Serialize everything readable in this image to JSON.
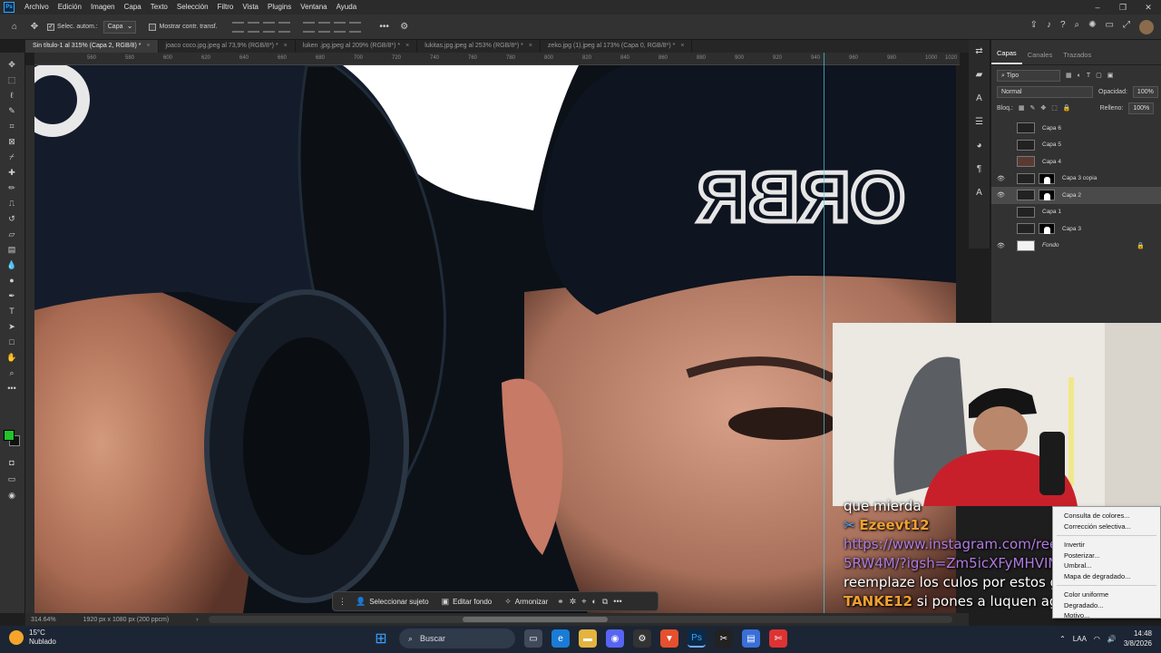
{
  "app": {
    "logo": "Ps"
  },
  "menu": [
    "Archivo",
    "Edición",
    "Imagen",
    "Capa",
    "Texto",
    "Selección",
    "Filtro",
    "Vista",
    "Plugins",
    "Ventana",
    "Ayuda"
  ],
  "options": {
    "auto_select_label": "Selec. autom.:",
    "auto_select_value": "Capa",
    "show_transform_label": "Mostrar contr. transf."
  },
  "tabs": [
    {
      "label": "Sin título-1 al 315% (Capa 2, RGB/8) *",
      "active": true
    },
    {
      "label": "joaco coco.jpg.jpeg al 73,9% (RGB/8*) *"
    },
    {
      "label": "luken .jpg.jpeg al 209% (RGB/8*) *"
    },
    {
      "label": "lukitas.jpg.jpeg al 253% (RGB/8*) *"
    },
    {
      "label": "zeko.jpg (1).jpeg al 173% (Capa 0, RGB/8*) *"
    }
  ],
  "ruler": [
    "560",
    "580",
    "600",
    "620",
    "640",
    "660",
    "680",
    "700",
    "720",
    "740",
    "760",
    "780",
    "800",
    "820",
    "840",
    "860",
    "880",
    "900",
    "920",
    "940",
    "960",
    "980",
    "1000",
    "1020"
  ],
  "ctxbar": {
    "select_subject": "Seleccionar sujeto",
    "edit_background": "Editar fondo",
    "harmonize": "Armonizar"
  },
  "status": {
    "zoom": "314.64%",
    "doc_size": "1920 px x 1080 px (200 ppcm)"
  },
  "panel": {
    "tabs": [
      "Capas",
      "Canales",
      "Trazados"
    ],
    "filter_label": "Tipo",
    "blend_mode": "Normal",
    "opacity_label": "Opacidad:",
    "opacity_value": "100%",
    "lock_label": "Bloq.:",
    "fill_label": "Relleno:",
    "fill_value": "100%",
    "layers": [
      {
        "name": "Capa 6",
        "visible": false,
        "mask": false
      },
      {
        "name": "Capa 5",
        "visible": false,
        "mask": false
      },
      {
        "name": "Capa 4",
        "visible": false,
        "mask": false
      },
      {
        "name": "Capa 3 copia",
        "visible": true,
        "mask": true
      },
      {
        "name": "Capa 2",
        "visible": true,
        "mask": true,
        "selected": true
      },
      {
        "name": "Capa 1",
        "visible": false,
        "mask": false
      },
      {
        "name": "Capa 3",
        "visible": false,
        "mask": true
      },
      {
        "name": "Fondo",
        "visible": true,
        "mask": false,
        "locked": true
      }
    ]
  },
  "cap_text": "ORBR",
  "chat": [
    {
      "user": "",
      "text": "que mierda"
    },
    {
      "user": "Ezeevt12",
      "text": ""
    },
    {
      "user": "",
      "text": "https://www.instagram.com/reel/DZzhsJ"
    },
    {
      "user": "",
      "text": "5RW4M/?igsh=Zm5icXFyMHVINXI5"
    },
    {
      "user": "",
      "text": "reemplaze los culos por estos gatos"
    },
    {
      "user": "TANKE12",
      "text": "si pones a luquen agrega a bi"
    }
  ],
  "context_menu": [
    "Consulta de colores...",
    "Corrección selectiva...",
    "-",
    "Invertir",
    "Posterizar...",
    "Umbral...",
    "Mapa de degradado...",
    "-",
    "Color uniforme",
    "Degradado...",
    "Motivo..."
  ],
  "taskbar": {
    "temp": "15°C",
    "weather": "Nublado",
    "search": "Buscar",
    "lang": "LAA",
    "time": "14:48",
    "date": "3/8/2026"
  }
}
